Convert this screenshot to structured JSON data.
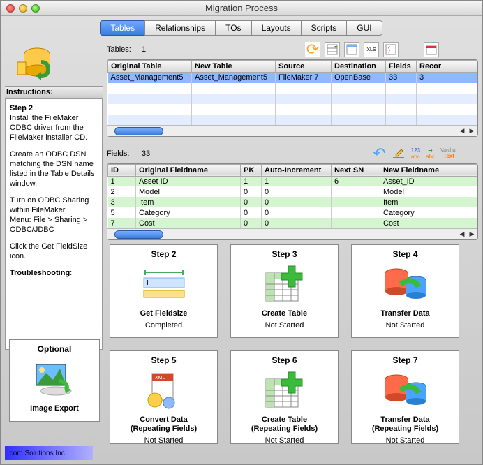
{
  "window": {
    "title": "Migration Process"
  },
  "tabs": [
    "Tables",
    "Relationships",
    "TOs",
    "Layouts",
    "Scripts",
    "GUI"
  ],
  "sidebar": {
    "instructions_label": "Instructions:",
    "step_label": "Step 2",
    "p1": "Install the FileMaker ODBC driver from the FileMaker installer CD.",
    "p2": "Create an ODBC DSN matching the DSN name listed in the Table Details window.",
    "p3a": "Turn on ODBC Sharing within FileMaker.",
    "p3b": "Menu: File > Sharing > ODBC/JDBC",
    "p4": "Click the Get FieldSize icon.",
    "troubleshooting": "Troubleshooting"
  },
  "tables": {
    "label": "Tables:",
    "count": "1",
    "columns": [
      "Original Table",
      "New Table",
      "Source",
      "Destination",
      "Fields",
      "Recor"
    ],
    "rows": [
      [
        "Asset_Management5",
        "Asset_Management5",
        "FileMaker 7",
        "OpenBase",
        "33",
        "3"
      ]
    ]
  },
  "fields": {
    "label": "Fields:",
    "count": "33",
    "columns": [
      "ID",
      "Original Fieldname",
      "PK",
      "Auto-Increment",
      "Next SN",
      "New Fieldname"
    ],
    "rows": [
      [
        "1",
        "Asset ID",
        "1",
        "1",
        "6",
        "Asset_ID"
      ],
      [
        "2",
        "Model",
        "0",
        "0",
        "",
        "Model"
      ],
      [
        "3",
        "Item",
        "0",
        "0",
        "",
        "Item"
      ],
      [
        "5",
        "Category",
        "0",
        "0",
        "",
        "Category"
      ],
      [
        "7",
        "Cost",
        "0",
        "0",
        "",
        "Cost"
      ]
    ]
  },
  "steps": [
    {
      "title": "Step 2",
      "name": "Get Fieldsize",
      "status": "Completed"
    },
    {
      "title": "Step 3",
      "name": "Create Table",
      "status": "Not Started"
    },
    {
      "title": "Step 4",
      "name": "Transfer Data",
      "status": "Not Started"
    },
    {
      "title": "Step 5",
      "name": "Convert Data",
      "sub": "(Repeating Fields)",
      "status": "Not Started"
    },
    {
      "title": "Step 6",
      "name": "Create Table",
      "sub": "(Repeating Fields)",
      "status": "Not Started"
    },
    {
      "title": "Step 7",
      "name": "Transfer Data",
      "sub": "(Repeating Fields)",
      "status": "Not Started"
    }
  ],
  "optional": {
    "title": "Optional",
    "name": "Image Export"
  },
  "footer": {
    "company": ".com Solutions Inc."
  }
}
